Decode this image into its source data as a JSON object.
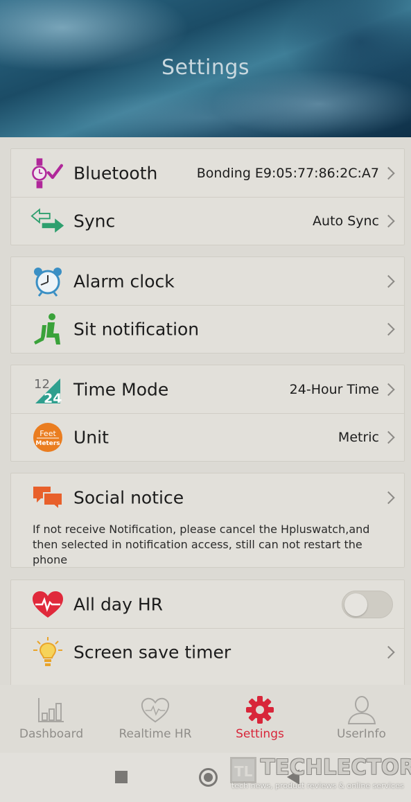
{
  "header": {
    "title": "Settings"
  },
  "groups": {
    "connection": {
      "bluetooth": {
        "label": "Bluetooth",
        "value": "Bonding E9:05:77:86:2C:A7",
        "icon": "watch-check-icon"
      },
      "sync": {
        "label": "Sync",
        "value": "Auto Sync",
        "icon": "sync-arrows-icon"
      }
    },
    "reminders": {
      "alarm": {
        "label": "Alarm clock",
        "icon": "alarm-clock-icon"
      },
      "sit": {
        "label": "Sit notification",
        "icon": "sitting-person-icon"
      }
    },
    "format": {
      "time_mode": {
        "label": "Time Mode",
        "value": "24-Hour Time",
        "icon": "time-12-24-icon"
      },
      "unit": {
        "label": "Unit",
        "value": "Metric",
        "icon": "feet-meters-icon",
        "icon_text_top": "Feet",
        "icon_text_bottom": "Meters"
      }
    },
    "social": {
      "label": "Social notice",
      "icon": "chat-bubbles-icon",
      "note": "If not receive Notification, please cancel the Hpluswatch,and then selected in notification access,  still can not restart the phone"
    },
    "health": {
      "all_day_hr": {
        "label": "All day HR",
        "icon": "heart-pulse-icon",
        "enabled": false
      },
      "screen_save": {
        "label": "Screen save timer",
        "icon": "light-bulb-icon"
      }
    }
  },
  "tabs": [
    {
      "label": "Dashboard",
      "icon": "bar-chart-icon",
      "active": false
    },
    {
      "label": "Realtime HR",
      "icon": "heart-outline-icon",
      "active": false
    },
    {
      "label": "Settings",
      "icon": "gear-icon",
      "active": true
    },
    {
      "label": "UserInfo",
      "icon": "user-icon",
      "active": false
    }
  ],
  "watermark": {
    "logo_letters": "TL",
    "name": "TECHLECTOR",
    "tagline": "tech news, product reviews & online services"
  },
  "colors": {
    "accent_red": "#d8263a",
    "bluetooth_purple": "#b0279a",
    "sync_green": "#2e9f6e",
    "unit_orange": "#ea7d20"
  }
}
